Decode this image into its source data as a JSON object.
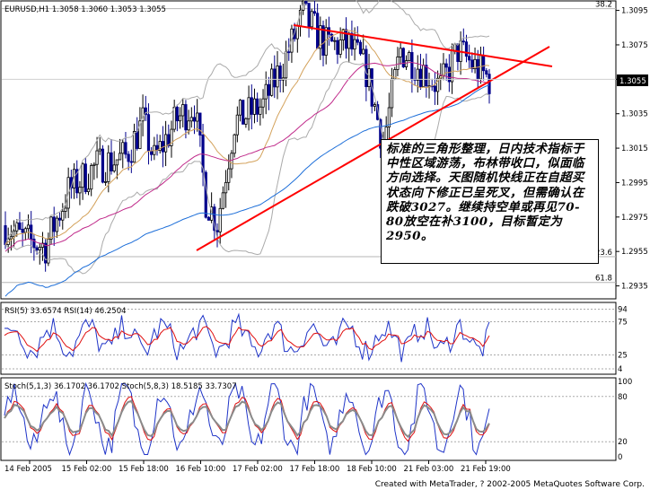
{
  "chart_data": [
    {
      "type": "candlestick",
      "title": "EURUSD,H1  1.3058 1.3060 1.3053 1.3055",
      "current_price": "1.3055",
      "price_ticks": [
        "1.3095",
        "1.3075",
        "1.3055",
        "1.3035",
        "1.3015",
        "1.2995",
        "1.2975",
        "1.2955",
        "1.2935"
      ],
      "price_range": [
        1.2928,
        1.31
      ],
      "fib_levels": [
        {
          "label": "38.2",
          "value": 1.3096
        },
        {
          "label": "23.6",
          "value": 1.2952
        },
        {
          "label": "61.8",
          "value": 1.2937
        }
      ],
      "colors": {
        "bull": "#000000",
        "bear": "#00008b",
        "trendline": "#ff0000",
        "ma_slow": "#1e6fd9",
        "ma_mid": "#c02a8a",
        "ma_fast": "#d3a15a",
        "bands": "#aaaaaa"
      }
    },
    {
      "type": "line",
      "title": "RSI(5) 33.6574  RSI(14) 46.2504",
      "levels": [
        "94",
        "75",
        "25",
        "4"
      ],
      "series": [
        {
          "name": "RSI(5)",
          "color": "#1f34c8"
        },
        {
          "name": "RSI(14)",
          "color": "#e01010"
        }
      ]
    },
    {
      "type": "line",
      "title": "Stoch(5,1,3) 36.1702 36.1702  Stoch(5,8,3) 18.5185 33.7307",
      "levels": [
        "100",
        "80",
        "20",
        "0"
      ],
      "series": [
        {
          "name": "Stoch(5,1,3)",
          "color": "#1f34c8"
        },
        {
          "name": "Stoch(5,8,3)",
          "color": "#e01010"
        }
      ]
    }
  ],
  "time_labels": [
    "14 Feb 2005",
    "15 Feb 02:00",
    "15 Feb 18:00",
    "16 Feb 10:00",
    "17 Feb 02:00",
    "17 Feb 18:00",
    "18 Feb 10:00",
    "21 Feb 03:00",
    "21 Feb 19:00"
  ],
  "annotation": {
    "text": "标准的三角形整理，日内技术指标于中性区域游荡，布林带收口，似面临方向选择。天图随机快线正在自超买状态向下修正已呈死叉，但需确认在跌破3027。继续持空单或再见70-80放空在补3100，目标暂定为2950。"
  },
  "footer": {
    "text": "Created with MetaTrader, ? 2002-2005 MetaQuotes Software Corp."
  }
}
